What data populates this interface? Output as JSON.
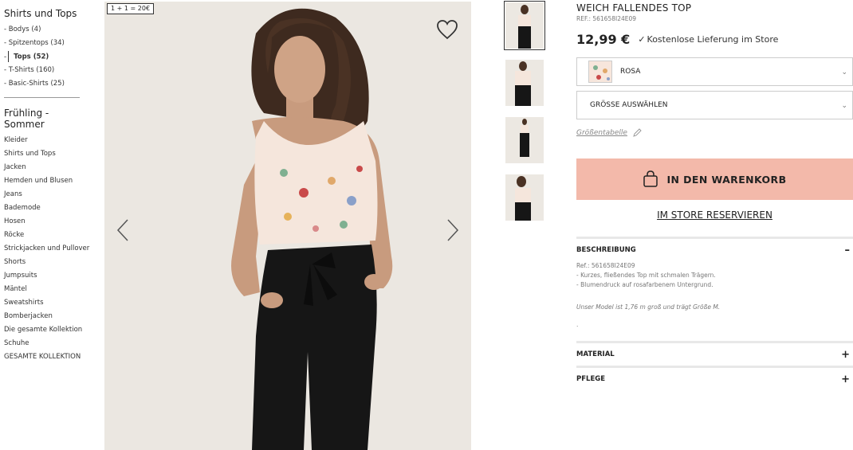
{
  "sidebar": {
    "title": "Shirts und Tops",
    "sub_items": [
      {
        "label": "- Bodys (4)"
      },
      {
        "label": "- Spitzentops (34)"
      },
      {
        "label": "Tops (52)"
      },
      {
        "label": "- T-Shirts (160)"
      },
      {
        "label": "- Basic-Shirts (25)"
      }
    ],
    "active_prefix": "-",
    "season_title_line1": "Frühling -",
    "season_title_line2": "Sommer",
    "categories": [
      "Kleider",
      "Shirts und Tops",
      "Jacken",
      "Hemden und Blusen",
      "Jeans",
      "Bademode",
      "Hosen",
      "Röcke",
      "Strickjacken und Pullover",
      "Shorts",
      "Jumpsuits",
      "Mäntel",
      "Sweatshirts",
      "Bomberjacken",
      "Die gesamte Kollektion",
      "Schuhe",
      "GESAMTE KOLLEKTION"
    ]
  },
  "gallery": {
    "promo": "1 + 1 = 20€",
    "heart_icon": "heart-icon",
    "prev_icon": "chevron-left-icon",
    "next_icon": "chevron-right-icon"
  },
  "product": {
    "title": "WEICH FALLENDES TOP",
    "ref": "REF.: 561658I24E09",
    "price": "12,99 €",
    "check": "✓",
    "delivery": "Kostenlose Lieferung im Store",
    "color_label": "ROSA",
    "size_label": "GRÖSSE AUSWÄHLEN",
    "chevron": "⌄",
    "size_guide": "Größentabelle",
    "cart_label": "IN DEN WARENKORB",
    "reserve_label": "IM STORE RESERVIEREN"
  },
  "sections": {
    "description": {
      "title": "BESCHREIBUNG",
      "toggle": "–",
      "lines": [
        "Ref.: 561658I24E09",
        "- Kurzes, fließendes Top mit schmalen Trägern.",
        "- Blumendruck auf rosafarbenem Untergrund."
      ],
      "model": "Unser Model ist 1,76 m groß und trägt Größe M.",
      "dot": "."
    },
    "material": {
      "title": "MATERIAL",
      "toggle": "+"
    },
    "care": {
      "title": "PFLEGE",
      "toggle": "+"
    }
  },
  "colors": {
    "accent_button": "#f3b9aa",
    "skin": "#c79a7d",
    "pants": "#161616",
    "hair": "#3e2a1f",
    "bg": "#ebe7e1"
  }
}
